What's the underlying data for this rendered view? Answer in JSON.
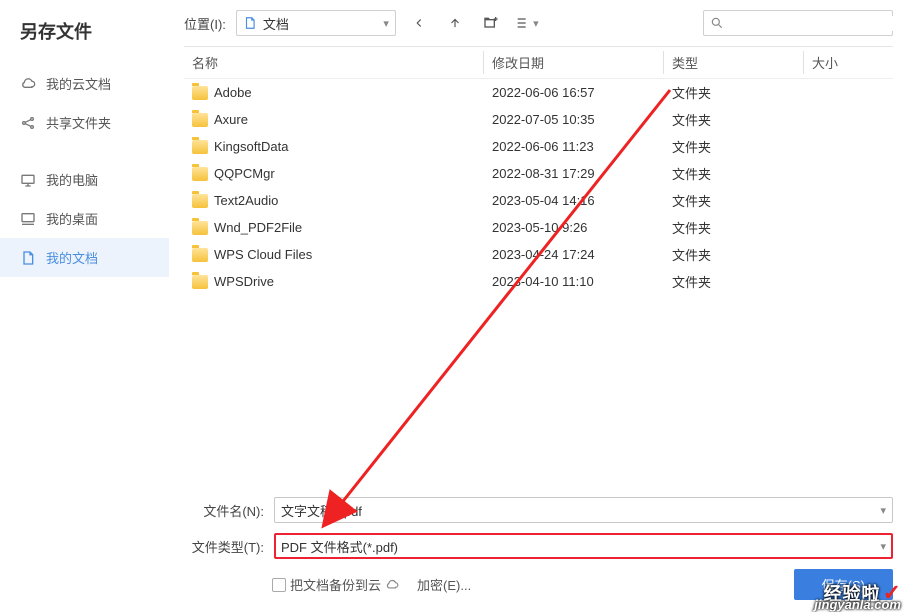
{
  "title": "另存文件",
  "sidebar": {
    "items": [
      {
        "label": "我的云文档"
      },
      {
        "label": "共享文件夹"
      },
      {
        "label": "我的电脑"
      },
      {
        "label": "我的桌面"
      },
      {
        "label": "我的文档"
      }
    ]
  },
  "toolbar": {
    "locationLabel": "位置(I):",
    "locationValue": "文档"
  },
  "headers": {
    "name": "名称",
    "modified": "修改日期",
    "type": "类型",
    "size": "大小"
  },
  "rows": [
    {
      "name": "Adobe",
      "modified": "2022-06-06 16:57",
      "type": "文件夹"
    },
    {
      "name": "Axure",
      "modified": "2022-07-05 10:35",
      "type": "文件夹"
    },
    {
      "name": "KingsoftData",
      "modified": "2022-06-06 11:23",
      "type": "文件夹"
    },
    {
      "name": "QQPCMgr",
      "modified": "2022-08-31 17:29",
      "type": "文件夹"
    },
    {
      "name": "Text2Audio",
      "modified": "2023-05-04 14:16",
      "type": "文件夹"
    },
    {
      "name": "Wnd_PDF2File",
      "modified": "2023-05-10 9:26",
      "type": "文件夹"
    },
    {
      "name": "WPS Cloud Files",
      "modified": "2023-04-24 17:24",
      "type": "文件夹"
    },
    {
      "name": "WPSDrive",
      "modified": "2023-04-10 11:10",
      "type": "文件夹"
    }
  ],
  "filename": {
    "label": "文件名(N):",
    "value": "文字文稿2.pdf"
  },
  "filetype": {
    "label": "文件类型(T):",
    "value": "PDF 文件格式(*.pdf)"
  },
  "backup": {
    "label": "把文档备份到云"
  },
  "encrypt": {
    "label": "加密(E)..."
  },
  "save": {
    "label": "保存(S)"
  },
  "watermark": {
    "brand": "经验啦",
    "url": "jingyanla.com"
  }
}
